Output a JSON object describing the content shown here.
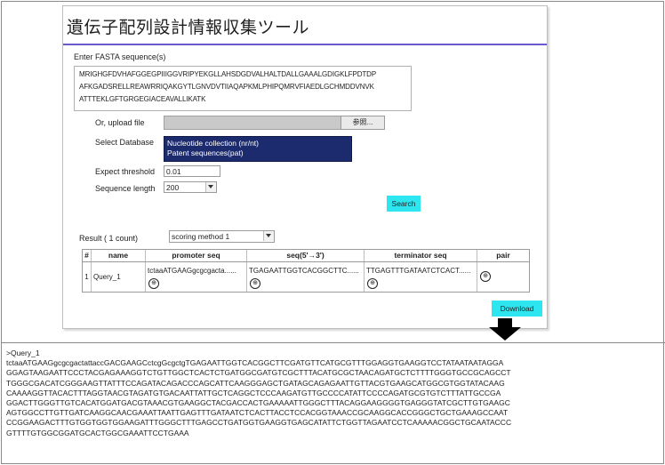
{
  "app": {
    "title": "遺伝子配列設計情報収集ツール"
  },
  "fasta": {
    "label": "Enter FASTA sequence(s)",
    "lines": [
      "MRIGHGFDVHAFGGEGPIIIGGVRIPYEKGLLAHSDGDVALHALTDALLGAAALGDIGKLFPDTDP",
      "AFKGADSRELLREAWRRIQAKGYTLGNVDVTIIAQAPKMLPHIPQMRVFIAEDLGCHMDDVNVK",
      "ATTTEKLGFTGRGEGIACEAVALLIKATK"
    ]
  },
  "upload": {
    "label": "Or, upload file",
    "browse_label": "参照..."
  },
  "database": {
    "label": "Select Database",
    "options": [
      "Nucleotide collection (nr/nt)",
      "Patent sequences(pat)"
    ]
  },
  "expect": {
    "label": "Expect threshold",
    "value": "0.01"
  },
  "seqlen": {
    "label": "Sequence length",
    "value": "200"
  },
  "search_label": "Search",
  "result": {
    "label": "Result ( 1 count)",
    "method": "scoring method 1"
  },
  "table": {
    "headers": [
      "#",
      "name",
      "promoter seq",
      "seq(5'→3')",
      "terminator seq",
      "pair"
    ],
    "row": {
      "index": "1",
      "name": "Query_1",
      "promoter": "tctaaATGAAGgcgcgacta......",
      "seq": "TGAGAATTGGTCACGGCTTC......",
      "terminator": "TTGAGTTTGATAATCTCACT......",
      "circle": "⊕"
    }
  },
  "download_label": "Download",
  "output": {
    "header": ">Query_1",
    "lines": [
      "tctaaATGAAGgcgcgactattaccGACGAAGCctcgGcgctgTGAGAATTGGTCACGGCTTCGATGTTCATGCGTTTGGAGGTGAAGGTCCTATAATAATAGGA",
      "GGAGTAAGAATTCCCTACGAGAAAGGTCTGTTGGCTCACTCTGATGGCGATGTCGCTTTACATGCGCTAACAGATGCTCTTTTGGGTGCCGCAGCCT",
      "TGGGCGACATCGGGAAGTTATTTCCAGATACAGACCCAGCATTCAAGGGAGCTGATAGCAGAGAATTGTTACGTGAAGCATGGCGTGGTATACAAG",
      "CAAAAGGTTACACTTTAGGTAACGTAGATGTGACAATTATTGCTCAGGCTCCCAAGATGTTGCCCCATATTCCCCAGATGCGTGTCTTTATTGCCGA",
      "GGACTTGGGTTGTCACATGGATGACGTAAACGTGAAGGCTACGACCACTGAAAAATTGGGCTTTACAGGAAGGGGTGAGGGTATCGCTTGTGAAGC",
      "AGTGGCCTTGTTGATCAAGGCAACGAAATTAATTGAGTTTGATAATCTCACTTACCTCCACGGTAAACCGCAAGGCACCGGGCTGCTGAAAGCCAAT",
      "CCGGAAGACTTTGTGGTGGTGGAAGATTTGGGCTTTGAGCCTGATGGTGAAGGTGAGCATATTCTGGTTAGAATCCTCAAAAACGGCTGCAATACCC",
      "GTTTTGTGGCGGATGCACTGGCGAAATTCCTGAAA"
    ]
  }
}
